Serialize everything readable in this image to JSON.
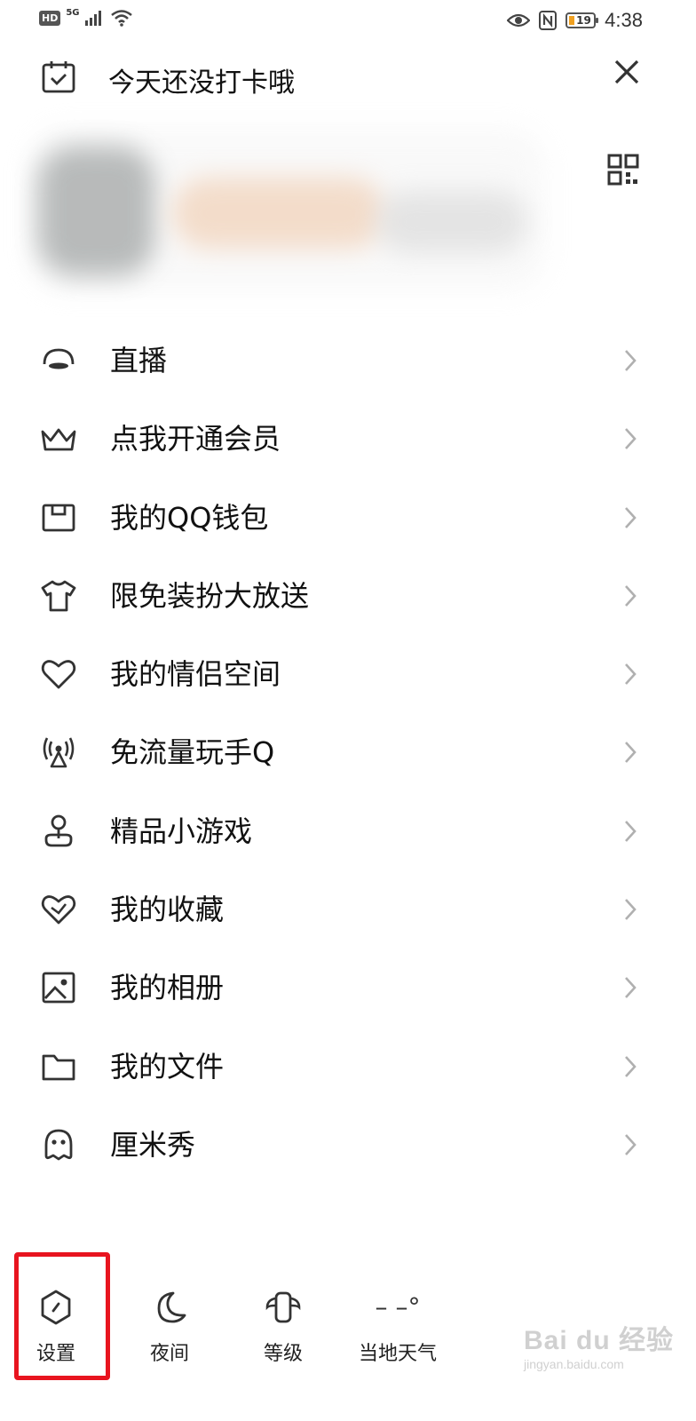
{
  "status_bar": {
    "hd": "HD",
    "signal_type": "5G",
    "battery_level": "19",
    "time": "4:38",
    "icons": [
      "signal-icon",
      "wifi-icon",
      "eye-icon",
      "nfc-icon",
      "battery-icon"
    ]
  },
  "header": {
    "checkin_text": "今天还没打卡哦",
    "icons": [
      "calendar-check-icon",
      "close-icon"
    ]
  },
  "profile": {
    "blurred": true,
    "icons": [
      "qr-code-icon"
    ]
  },
  "menu": {
    "items": [
      {
        "label": "直播",
        "icon": "live-icon"
      },
      {
        "label": "点我开通会员",
        "icon": "crown-icon"
      },
      {
        "label": "我的QQ钱包",
        "icon": "wallet-icon"
      },
      {
        "label": "限免装扮大放送",
        "icon": "tshirt-icon"
      },
      {
        "label": "我的情侣空间",
        "icon": "heart-icon"
      },
      {
        "label": "免流量玩手Q",
        "icon": "signal-tower-icon"
      },
      {
        "label": "精品小游戏",
        "icon": "joystick-icon"
      },
      {
        "label": "我的收藏",
        "icon": "favorite-heart-icon"
      },
      {
        "label": "我的相册",
        "icon": "photo-icon"
      },
      {
        "label": "我的文件",
        "icon": "folder-icon"
      },
      {
        "label": "厘米秀",
        "icon": "ghost-icon"
      }
    ]
  },
  "bottom_bar": {
    "items": [
      {
        "label": "设置",
        "icon": "settings-icon"
      },
      {
        "label": "夜间",
        "icon": "moon-icon"
      },
      {
        "label": "等级",
        "icon": "level-icon"
      },
      {
        "label": "当地天气",
        "icon": "weather-icon"
      }
    ],
    "weather_value": "– –°"
  },
  "watermark": {
    "main": "Bai du 经验",
    "sub": "jingyan.baidu.com"
  },
  "colors": {
    "highlight_border": "#e8141f",
    "text": "#111111",
    "icon": "#333333",
    "chevron": "#b0b0b0"
  }
}
